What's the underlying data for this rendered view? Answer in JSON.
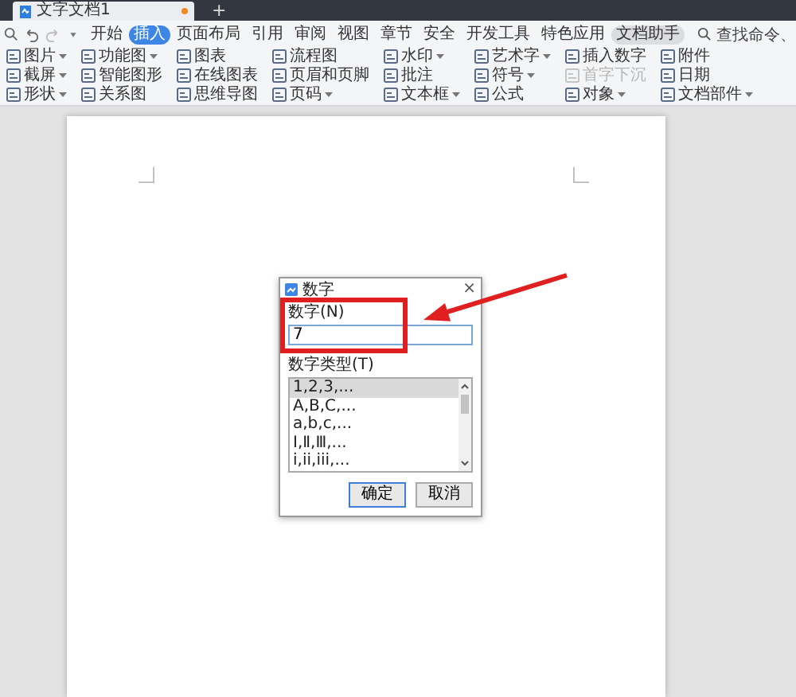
{
  "title_bar": {
    "document_tab": {
      "title": "文字文档1",
      "modified": true
    },
    "new_tab": "+"
  },
  "menu_bar": {
    "tabs": [
      {
        "label": "开始",
        "selected": false,
        "highlighted": false
      },
      {
        "label": "插入",
        "selected": true,
        "highlighted": false
      },
      {
        "label": "页面布局",
        "selected": false,
        "highlighted": false
      },
      {
        "label": "引用",
        "selected": false,
        "highlighted": false
      },
      {
        "label": "审阅",
        "selected": false,
        "highlighted": false
      },
      {
        "label": "视图",
        "selected": false,
        "highlighted": false
      },
      {
        "label": "章节",
        "selected": false,
        "highlighted": false
      },
      {
        "label": "安全",
        "selected": false,
        "highlighted": false
      },
      {
        "label": "开发工具",
        "selected": false,
        "highlighted": false
      },
      {
        "label": "特色应用",
        "selected": false,
        "highlighted": false
      },
      {
        "label": "文档助手",
        "selected": false,
        "highlighted": true
      }
    ],
    "search": {
      "placeholder": "查找命令、"
    }
  },
  "ribbon": {
    "items": [
      {
        "label": "图片",
        "caret": true,
        "disabled": false
      },
      {
        "label": "截屏",
        "caret": true,
        "disabled": false
      },
      {
        "label": "形状",
        "caret": true,
        "disabled": false
      },
      {
        "label": "功能图",
        "caret": true,
        "disabled": false
      },
      {
        "label": "智能图形",
        "caret": false,
        "disabled": false
      },
      {
        "label": "关系图",
        "caret": false,
        "disabled": false
      },
      {
        "label": "图表",
        "caret": false,
        "disabled": false
      },
      {
        "label": "在线图表",
        "caret": false,
        "disabled": false
      },
      {
        "label": "思维导图",
        "caret": false,
        "disabled": false
      },
      {
        "label": "流程图",
        "caret": false,
        "disabled": false
      },
      {
        "label": "页眉和页脚",
        "caret": false,
        "disabled": false
      },
      {
        "label": "页码",
        "caret": true,
        "disabled": false
      },
      {
        "label": "水印",
        "caret": true,
        "disabled": false
      },
      {
        "label": "批注",
        "caret": false,
        "disabled": false
      },
      {
        "label": "文本框",
        "caret": true,
        "disabled": false
      },
      {
        "label": "艺术字",
        "caret": true,
        "disabled": false
      },
      {
        "label": "符号",
        "caret": true,
        "disabled": false
      },
      {
        "label": "公式",
        "caret": false,
        "disabled": false
      },
      {
        "label": "插入数字",
        "caret": false,
        "disabled": false
      },
      {
        "label": "首字下沉",
        "caret": false,
        "disabled": true
      },
      {
        "label": "对象",
        "caret": true,
        "disabled": false
      },
      {
        "label": "附件",
        "caret": false,
        "disabled": false
      },
      {
        "label": "日期",
        "caret": false,
        "disabled": false
      },
      {
        "label": "文档部件",
        "caret": true,
        "disabled": false
      }
    ]
  },
  "dialog": {
    "title": "数字",
    "close": "×",
    "number_label": "数字(N)",
    "number_value": "7",
    "type_label": "数字类型(T)",
    "types": [
      {
        "label": "1,2,3,...",
        "selected": true
      },
      {
        "label": "A,B,C,...",
        "selected": false
      },
      {
        "label": "a,b,c,...",
        "selected": false
      },
      {
        "label": "Ⅰ,Ⅱ,Ⅲ,...",
        "selected": false
      },
      {
        "label": "i,ii,iii,...",
        "selected": false
      }
    ],
    "buttons": [
      "确定",
      "取消"
    ]
  }
}
